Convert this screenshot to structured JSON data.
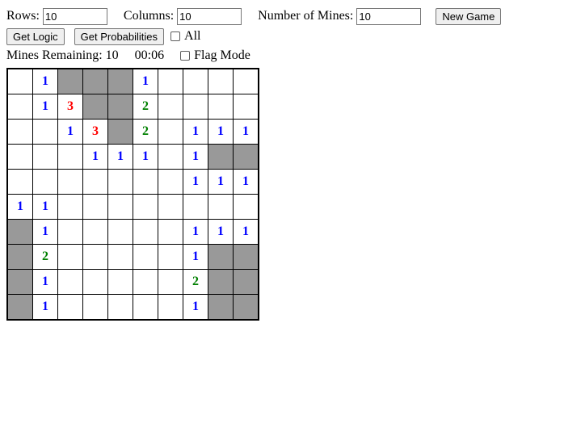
{
  "controls": {
    "rows_label": "Rows:",
    "rows_value": "10",
    "columns_label": "Columns:",
    "columns_value": "10",
    "mines_label": "Number of Mines:",
    "mines_value": "10",
    "new_game_label": "New Game",
    "get_logic_label": "Get Logic",
    "get_probabilities_label": "Get Probabilities",
    "all_checkbox_label": "All",
    "all_checked": false,
    "flag_mode_label": "Flag Mode",
    "flag_mode_checked": false
  },
  "status": {
    "mines_remaining_text": "Mines Remaining: 10",
    "timer_text": "00:06"
  },
  "board": {
    "rows": 10,
    "columns": 10,
    "colors": {
      "hidden": "#999999",
      "revealed": "#ffffff",
      "border": "#000000",
      "n1": "#0000ff",
      "n2": "#008000",
      "n3": "#ff0000"
    },
    "cells": [
      [
        {
          "state": "open",
          "value": ""
        },
        {
          "state": "open",
          "value": "1"
        },
        {
          "state": "hidden",
          "value": ""
        },
        {
          "state": "hidden",
          "value": ""
        },
        {
          "state": "hidden",
          "value": ""
        },
        {
          "state": "open",
          "value": "1"
        },
        {
          "state": "open",
          "value": ""
        },
        {
          "state": "open",
          "value": ""
        },
        {
          "state": "open",
          "value": ""
        },
        {
          "state": "open",
          "value": ""
        }
      ],
      [
        {
          "state": "open",
          "value": ""
        },
        {
          "state": "open",
          "value": "1"
        },
        {
          "state": "open",
          "value": "3"
        },
        {
          "state": "hidden",
          "value": ""
        },
        {
          "state": "hidden",
          "value": ""
        },
        {
          "state": "open",
          "value": "2"
        },
        {
          "state": "open",
          "value": ""
        },
        {
          "state": "open",
          "value": ""
        },
        {
          "state": "open",
          "value": ""
        },
        {
          "state": "open",
          "value": ""
        }
      ],
      [
        {
          "state": "open",
          "value": ""
        },
        {
          "state": "open",
          "value": ""
        },
        {
          "state": "open",
          "value": "1"
        },
        {
          "state": "open",
          "value": "3"
        },
        {
          "state": "hidden",
          "value": ""
        },
        {
          "state": "open",
          "value": "2"
        },
        {
          "state": "open",
          "value": ""
        },
        {
          "state": "open",
          "value": "1"
        },
        {
          "state": "open",
          "value": "1"
        },
        {
          "state": "open",
          "value": "1"
        }
      ],
      [
        {
          "state": "open",
          "value": ""
        },
        {
          "state": "open",
          "value": ""
        },
        {
          "state": "open",
          "value": ""
        },
        {
          "state": "open",
          "value": "1"
        },
        {
          "state": "open",
          "value": "1"
        },
        {
          "state": "open",
          "value": "1"
        },
        {
          "state": "open",
          "value": ""
        },
        {
          "state": "open",
          "value": "1"
        },
        {
          "state": "hidden",
          "value": ""
        },
        {
          "state": "hidden",
          "value": ""
        }
      ],
      [
        {
          "state": "open",
          "value": ""
        },
        {
          "state": "open",
          "value": ""
        },
        {
          "state": "open",
          "value": ""
        },
        {
          "state": "open",
          "value": ""
        },
        {
          "state": "open",
          "value": ""
        },
        {
          "state": "open",
          "value": ""
        },
        {
          "state": "open",
          "value": ""
        },
        {
          "state": "open",
          "value": "1"
        },
        {
          "state": "open",
          "value": "1"
        },
        {
          "state": "open",
          "value": "1"
        }
      ],
      [
        {
          "state": "open",
          "value": "1"
        },
        {
          "state": "open",
          "value": "1"
        },
        {
          "state": "open",
          "value": ""
        },
        {
          "state": "open",
          "value": ""
        },
        {
          "state": "open",
          "value": ""
        },
        {
          "state": "open",
          "value": ""
        },
        {
          "state": "open",
          "value": ""
        },
        {
          "state": "open",
          "value": ""
        },
        {
          "state": "open",
          "value": ""
        },
        {
          "state": "open",
          "value": ""
        }
      ],
      [
        {
          "state": "hidden",
          "value": ""
        },
        {
          "state": "open",
          "value": "1"
        },
        {
          "state": "open",
          "value": ""
        },
        {
          "state": "open",
          "value": ""
        },
        {
          "state": "open",
          "value": ""
        },
        {
          "state": "open",
          "value": ""
        },
        {
          "state": "open",
          "value": ""
        },
        {
          "state": "open",
          "value": "1"
        },
        {
          "state": "open",
          "value": "1"
        },
        {
          "state": "open",
          "value": "1"
        }
      ],
      [
        {
          "state": "hidden",
          "value": ""
        },
        {
          "state": "open",
          "value": "2"
        },
        {
          "state": "open",
          "value": ""
        },
        {
          "state": "open",
          "value": ""
        },
        {
          "state": "open",
          "value": ""
        },
        {
          "state": "open",
          "value": ""
        },
        {
          "state": "open",
          "value": ""
        },
        {
          "state": "open",
          "value": "1"
        },
        {
          "state": "hidden",
          "value": ""
        },
        {
          "state": "hidden",
          "value": ""
        }
      ],
      [
        {
          "state": "hidden",
          "value": ""
        },
        {
          "state": "open",
          "value": "1"
        },
        {
          "state": "open",
          "value": ""
        },
        {
          "state": "open",
          "value": ""
        },
        {
          "state": "open",
          "value": ""
        },
        {
          "state": "open",
          "value": ""
        },
        {
          "state": "open",
          "value": ""
        },
        {
          "state": "open",
          "value": "2"
        },
        {
          "state": "hidden",
          "value": ""
        },
        {
          "state": "hidden",
          "value": ""
        }
      ],
      [
        {
          "state": "hidden",
          "value": ""
        },
        {
          "state": "open",
          "value": "1"
        },
        {
          "state": "open",
          "value": ""
        },
        {
          "state": "open",
          "value": ""
        },
        {
          "state": "open",
          "value": ""
        },
        {
          "state": "open",
          "value": ""
        },
        {
          "state": "open",
          "value": ""
        },
        {
          "state": "open",
          "value": "1"
        },
        {
          "state": "hidden",
          "value": ""
        },
        {
          "state": "hidden",
          "value": ""
        }
      ]
    ]
  }
}
